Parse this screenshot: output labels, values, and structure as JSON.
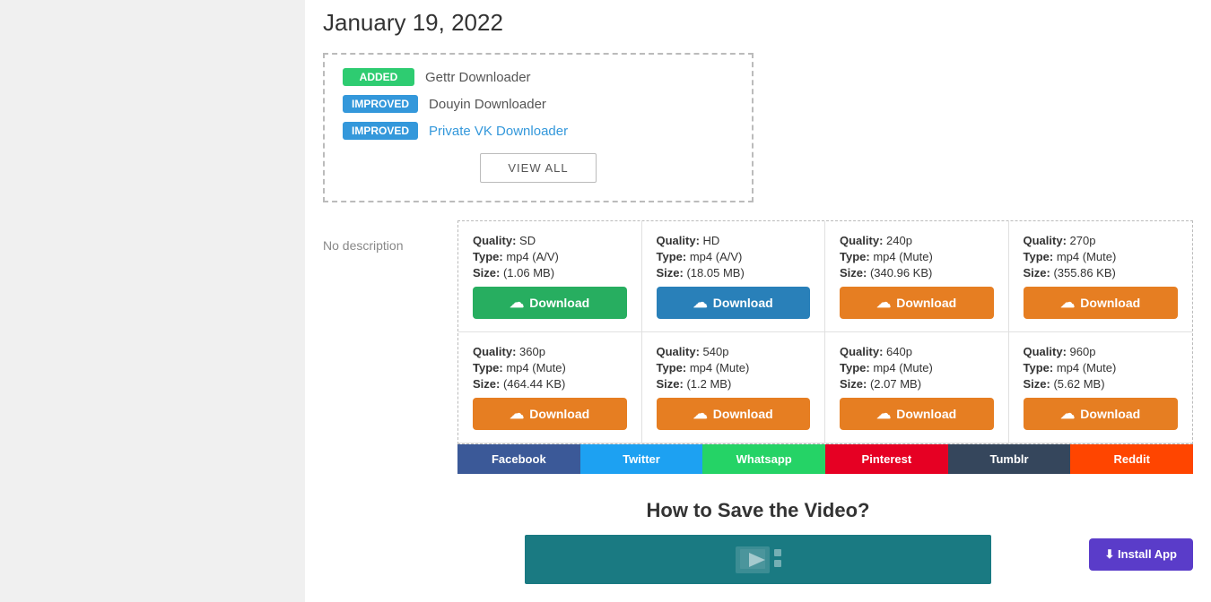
{
  "date": "January 19, 2022",
  "changelog": {
    "items": [
      {
        "badge": "ADDED",
        "badge_type": "added",
        "text": "Gettr Downloader",
        "link_style": "normal"
      },
      {
        "badge": "IMPROVED",
        "badge_type": "improved",
        "text": "Douyin Downloader",
        "link_style": "normal"
      },
      {
        "badge": "IMPROVED",
        "badge_type": "improved",
        "text": "Private VK Downloader",
        "link_style": "blue"
      }
    ],
    "view_all_label": "VIEW ALL"
  },
  "download_options": {
    "row1": [
      {
        "quality_label": "Quality:",
        "quality_val": "SD",
        "type_label": "Type:",
        "type_val": "mp4 (A/V)",
        "size_label": "Size:",
        "size_val": "(1.06 MB)",
        "btn_color": "green",
        "btn_label": "Download"
      },
      {
        "quality_label": "Quality:",
        "quality_val": "HD",
        "type_label": "Type:",
        "type_val": "mp4 (A/V)",
        "size_label": "Size:",
        "size_val": "(18.05 MB)",
        "btn_color": "blue",
        "btn_label": "Download"
      },
      {
        "quality_label": "Quality:",
        "quality_val": "240p",
        "type_label": "Type:",
        "type_val": "mp4 (Mute)",
        "size_label": "Size:",
        "size_val": "(340.96 KB)",
        "btn_color": "orange",
        "btn_label": "Download"
      },
      {
        "quality_label": "Quality:",
        "quality_val": "270p",
        "type_label": "Type:",
        "type_val": "mp4 (Mute)",
        "size_label": "Size:",
        "size_val": "(355.86 KB)",
        "btn_color": "orange",
        "btn_label": "Download"
      }
    ],
    "row2": [
      {
        "quality_label": "Quality:",
        "quality_val": "360p",
        "type_label": "Type:",
        "type_val": "mp4 (Mute)",
        "size_label": "Size:",
        "size_val": "(464.44 KB)",
        "btn_color": "orange",
        "btn_label": "Download"
      },
      {
        "quality_label": "Quality:",
        "quality_val": "540p",
        "type_label": "Type:",
        "type_val": "mp4 (Mute)",
        "size_label": "Size:",
        "size_val": "(1.2 MB)",
        "btn_color": "orange",
        "btn_label": "Download"
      },
      {
        "quality_label": "Quality:",
        "quality_val": "640p",
        "type_label": "Type:",
        "type_val": "mp4 (Mute)",
        "size_label": "Size:",
        "size_val": "(2.07 MB)",
        "btn_color": "orange",
        "btn_label": "Download"
      },
      {
        "quality_label": "Quality:",
        "quality_val": "960p",
        "type_label": "Type:",
        "type_val": "mp4 (Mute)",
        "size_label": "Size:",
        "size_val": "(5.62 MB)",
        "btn_color": "orange",
        "btn_label": "Download"
      }
    ]
  },
  "social_buttons": [
    {
      "label": "Facebook",
      "style": "facebook"
    },
    {
      "label": "Twitter",
      "style": "twitter"
    },
    {
      "label": "Whatsapp",
      "style": "whatsapp"
    },
    {
      "label": "Pinterest",
      "style": "pinterest"
    },
    {
      "label": "Tumblr",
      "style": "tumblr"
    },
    {
      "label": "Reddit",
      "style": "reddit"
    }
  ],
  "no_description": "No description",
  "how_to_title": "How to Save the Video?",
  "install_app_label": "⬇ Install App"
}
